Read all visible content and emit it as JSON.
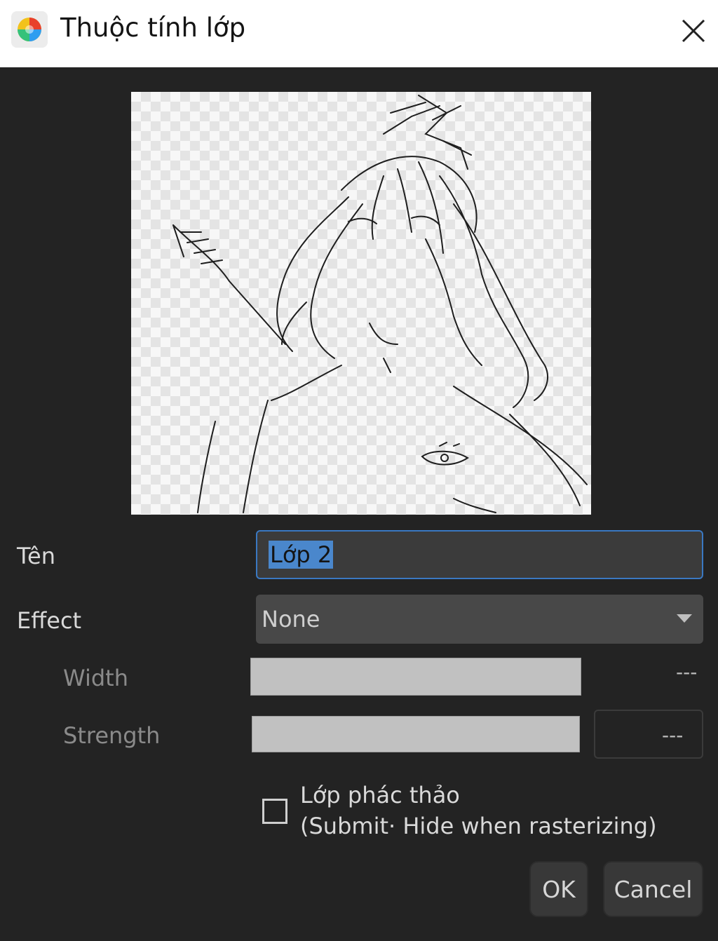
{
  "window": {
    "title": "Thuộc tính lớp",
    "app_icon": "color-wheel-icon",
    "close_icon": "close-icon"
  },
  "preview": {
    "description_icon": "layer-preview-sketch"
  },
  "form": {
    "name_label": "Tên",
    "name_value": "Lớp 2",
    "effect_label": "Effect",
    "effect_value": "None",
    "width_label": "Width",
    "width_value": "---",
    "strength_label": "Strength",
    "strength_value": "---",
    "draft_label_line1": "Lớp phác thảo",
    "draft_label_line2": "(Submit· Hide when rasterizing)",
    "draft_checked": false
  },
  "buttons": {
    "ok": "OK",
    "cancel": "Cancel"
  },
  "colors": {
    "background": "#232323",
    "selection": "#4a87cc",
    "focus_border": "#3a78c2"
  }
}
